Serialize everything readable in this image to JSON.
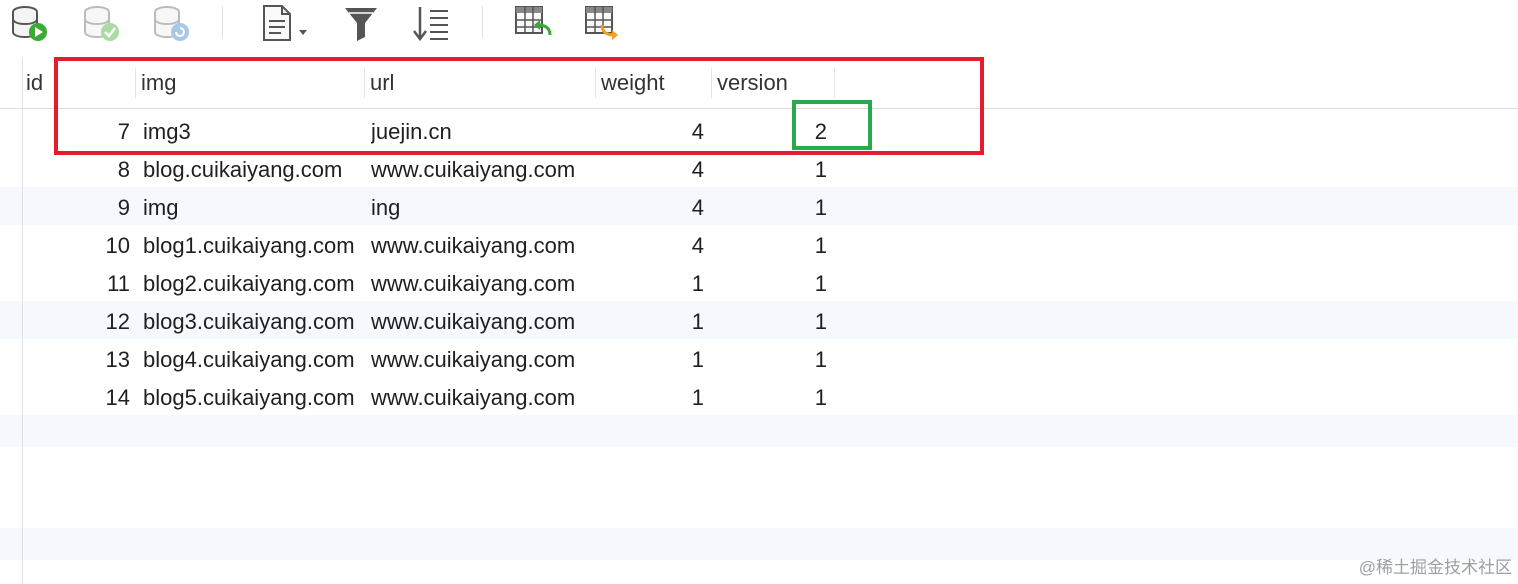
{
  "toolbar": {
    "buttons": [
      {
        "name": "run-query-icon"
      },
      {
        "name": "apply-changes-icon"
      },
      {
        "name": "revert-changes-icon"
      },
      {
        "name": "export-document-icon"
      },
      {
        "name": "filter-icon"
      },
      {
        "name": "sort-icon"
      },
      {
        "name": "import-table-icon"
      },
      {
        "name": "export-table-icon"
      }
    ]
  },
  "columns": {
    "id": "id",
    "img": "img",
    "url": "url",
    "weight": "weight",
    "version": "version"
  },
  "rows": [
    {
      "id": "7",
      "img": "img3",
      "url": "juejin.cn",
      "weight": "4",
      "version": "2"
    },
    {
      "id": "8",
      "img": "blog.cuikaiyang.com",
      "url": "www.cuikaiyang.com",
      "weight": "4",
      "version": "1"
    },
    {
      "id": "9",
      "img": "img",
      "url": "ing",
      "weight": "4",
      "version": "1"
    },
    {
      "id": "10",
      "img": "blog1.cuikaiyang.com",
      "url": "www.cuikaiyang.com",
      "weight": "4",
      "version": "1"
    },
    {
      "id": "11",
      "img": "blog2.cuikaiyang.com",
      "url": "www.cuikaiyang.com",
      "weight": "1",
      "version": "1"
    },
    {
      "id": "12",
      "img": "blog3.cuikaiyang.com",
      "url": "www.cuikaiyang.com",
      "weight": "1",
      "version": "1"
    },
    {
      "id": "13",
      "img": "blog4.cuikaiyang.com",
      "url": "www.cuikaiyang.com",
      "weight": "1",
      "version": "1"
    },
    {
      "id": "14",
      "img": "blog5.cuikaiyang.com",
      "url": "www.cuikaiyang.com",
      "weight": "1",
      "version": "1"
    }
  ],
  "colors": {
    "highlight_red": "#e31d2b",
    "highlight_green": "#2aa84e",
    "alt_row": "#f5f8fc"
  },
  "watermark": "@稀土掘金技术社区"
}
